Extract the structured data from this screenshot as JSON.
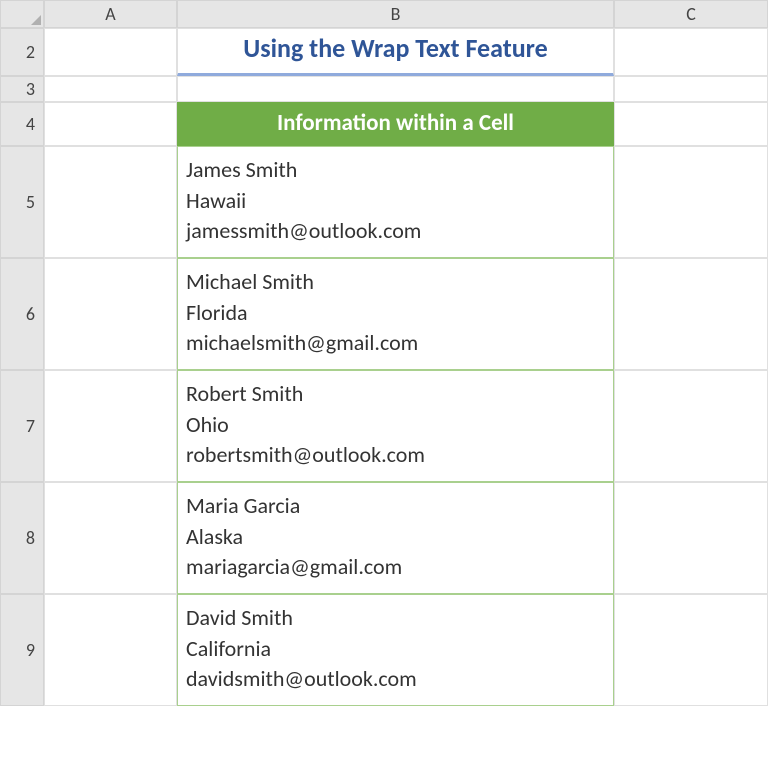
{
  "columns": {
    "A": "A",
    "B": "B",
    "C": "C"
  },
  "rows": [
    "2",
    "3",
    "4",
    "5",
    "6",
    "7",
    "8",
    "9"
  ],
  "title": "Using the Wrap Text Feature",
  "header": "Information within a Cell",
  "records": [
    "James Smith\nHawaii\njamessmith@outlook.com",
    "Michael Smith\nFlorida\nmichaelsmith@gmail.com",
    "Robert Smith\nOhio\nrobertsmith@outlook.com",
    "Maria Garcia\nAlaska\nmariagarcia@gmail.com",
    "David Smith\nCalifornia\ndavidsmith@outlook.com"
  ]
}
